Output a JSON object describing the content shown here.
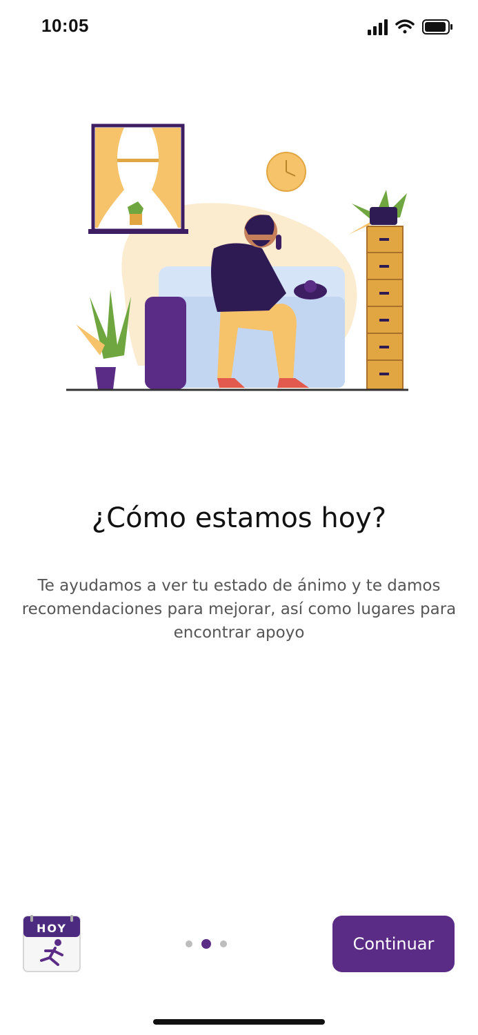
{
  "status_bar": {
    "time": "10:05",
    "icons": [
      "signal-icon",
      "wifi-icon",
      "battery-icon"
    ]
  },
  "onboarding": {
    "title": "¿Cómo estamos hoy?",
    "description": "Te ayudamos a ver tu estado de ánimo y te damos recomendaciones para mejorar, así como lugares para encontrar apoyo",
    "page_indicator": {
      "total": 3,
      "current": 2
    }
  },
  "app_logo": {
    "label": "HOY",
    "icon": "running-person-icon"
  },
  "actions": {
    "continue_label": "Continuar"
  },
  "colors": {
    "primary": "#5b2c86",
    "dot_inactive": "#bdbdbd",
    "text_secondary": "#555555"
  }
}
